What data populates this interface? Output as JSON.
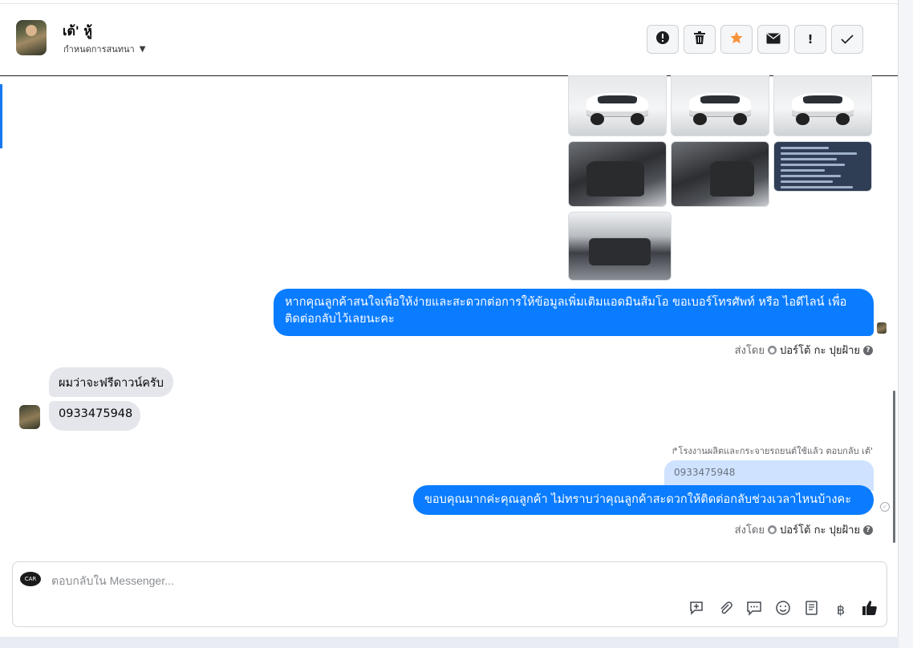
{
  "header": {
    "contact_name": "เต้' หู้",
    "conversation_label": "กำหนดการสนทนา",
    "toolbar": [
      {
        "name": "mark-spam-button",
        "icon": "alert-circle-icon",
        "glyph": "⬤"
      },
      {
        "name": "delete-button",
        "icon": "trash-icon",
        "glyph": "🗑"
      },
      {
        "name": "star-button",
        "icon": "star-icon",
        "glyph": "★"
      },
      {
        "name": "mark-unread-button",
        "icon": "envelope-icon",
        "glyph": "✉"
      },
      {
        "name": "follow-up-button",
        "icon": "exclamation-icon",
        "glyph": "!"
      },
      {
        "name": "mark-done-button",
        "icon": "check-icon",
        "glyph": "✓"
      }
    ]
  },
  "messages": {
    "outgoing_1": "หากคุณลูกค้าสนใจเพื่อให้ง่ายและสะดวกต่อการให้ข้อมูลเพิ่มเติมแอดมินส้มโอ ขอเบอร์โทรศัพท์ หรือ ไอดีไลน์ เพื่อติดต่อกลับไว้เลยนะคะ",
    "incoming_1": "ผมว่าจะฟรีดาวน์ครับ",
    "incoming_2": "0933475948",
    "reply_note": "↱โรงงานผลิตและกระจายรถยนต์ใช้แล้ว ตอบกลับ เต้'",
    "quoted_text": "0933475948",
    "outgoing_2": "ขอบคุณมากค่ะคุณลูกค้า ไม่ทราบว่าคุณลูกค้าสะดวกให้ติดต่อกลับช่วงเวลาไหนบ้างคะ",
    "sent_by_prefix": "ส่งโดย",
    "sent_by_name": "ปอร์โต้ กะ ปุยฝ้าย",
    "help_glyph": "?"
  },
  "composer": {
    "placeholder": "ตอบกลับใน Messenger...",
    "page_avatar_text": "CAR",
    "tools": [
      {
        "name": "quick-reply-button",
        "icon": "chat-plus-icon",
        "glyph": "💬"
      },
      {
        "name": "attach-button",
        "icon": "paperclip-icon",
        "glyph": "📎"
      },
      {
        "name": "saved-replies-button",
        "icon": "chat-dots-icon",
        "glyph": "🗨"
      },
      {
        "name": "emoji-button",
        "icon": "smiley-icon",
        "glyph": "☺"
      },
      {
        "name": "catalog-button",
        "icon": "book-icon",
        "glyph": "📖"
      },
      {
        "name": "payment-button",
        "icon": "baht-icon",
        "glyph": "฿"
      },
      {
        "name": "like-button",
        "icon": "thumbs-up-icon",
        "glyph": "👍"
      }
    ]
  },
  "colors": {
    "accent": "#0a7cff",
    "star": "#f7923a",
    "incoming_bubble": "#e4e6eb",
    "quote": "#cfe2ff"
  }
}
